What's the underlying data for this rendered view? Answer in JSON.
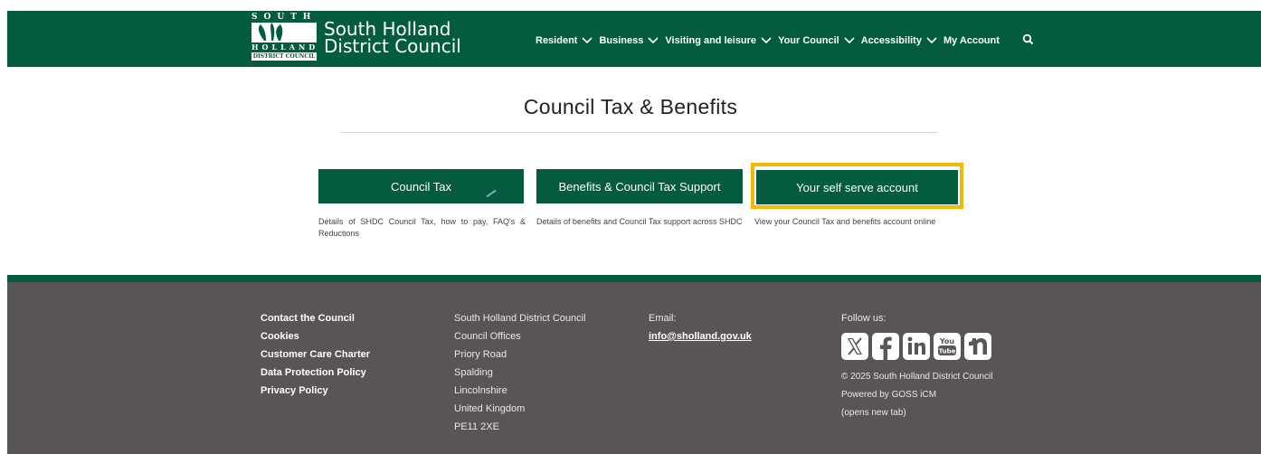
{
  "header": {
    "logo": {
      "mark_top": "SOUTH",
      "mark_mid": "HOLLAND",
      "mark_bottom": "DISTRICT COUNCIL",
      "line1": "South Holland",
      "line2": "District Council"
    },
    "nav": [
      {
        "label": "Resident",
        "icon": "chevron-down-icon"
      },
      {
        "label": "Business",
        "icon": "chevron-down-icon"
      },
      {
        "label": "Visiting and leisure",
        "icon": "chevron-down-icon"
      },
      {
        "label": "Your Council",
        "icon": "chevron-down-icon"
      },
      {
        "label": "Accessibility",
        "icon": "chevron-down-icon"
      },
      {
        "label": "My Account"
      }
    ],
    "search_icon": "search-icon"
  },
  "main": {
    "title": "Council Tax & Benefits",
    "cards": [
      {
        "label": "Council Tax",
        "description": "Details of SHDC Council Tax, how to pay, FAQ's & Reductions"
      },
      {
        "label": "Benefits & Council Tax Support",
        "description": "Details of benefits and Council Tax support across SHDC"
      },
      {
        "label": "Your self serve account",
        "description": "View your Council Tax and benefits account online"
      }
    ]
  },
  "footer": {
    "links": [
      "Contact the Council",
      "Cookies",
      "Customer Care Charter",
      "Data Protection Policy",
      "Privacy Policy"
    ],
    "address": [
      "South Holland District Council",
      "Council Offices",
      "Priory Road",
      "Spalding",
      "Lincolnshire",
      "United Kingdom",
      "PE11 2XE"
    ],
    "email_label": "Email:",
    "email": "info@sholland.gov.uk",
    "follow_label": "Follow us:",
    "social": [
      "x-icon",
      "facebook-icon",
      "linkedin-icon",
      "youtube-icon",
      "nextdoor-icon"
    ],
    "copyright": "© 2025 South Holland District Council",
    "powered": "Powered by GOSS iCM",
    "opens_new_tab": "(opens new tab)"
  },
  "colors": {
    "brand_green": "#035b40",
    "footer_grey": "#595455",
    "focus_yellow": "#f5b800"
  }
}
